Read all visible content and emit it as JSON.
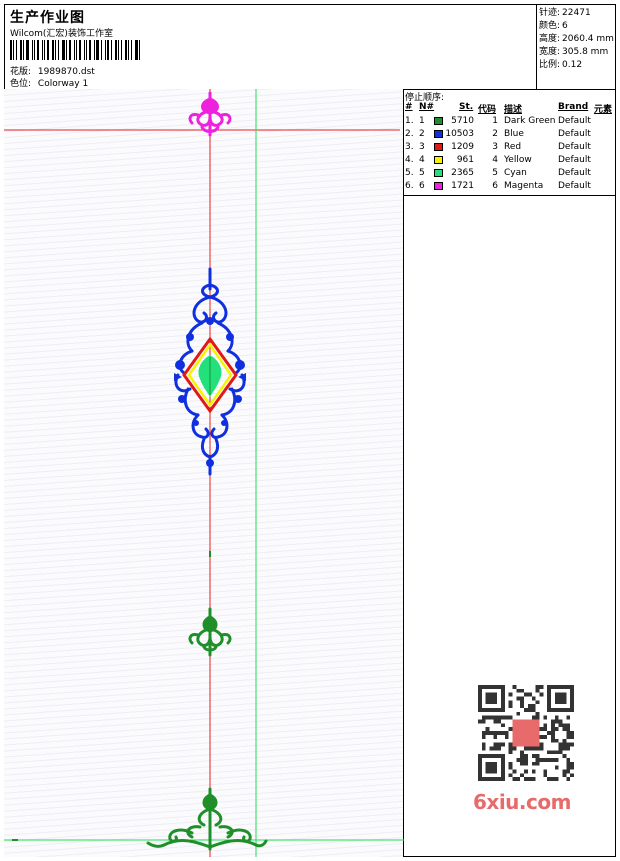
{
  "header": {
    "title": "生产作业图",
    "company": "Wilcom(汇宏)装饰工作室",
    "pattern_label": "花版:",
    "pattern_value": "1989870.dst",
    "colorway_label": "色位:",
    "colorway_value": "Colorway 1"
  },
  "stats": [
    {
      "label": "针迹:",
      "value": "22471"
    },
    {
      "label": "颜色:",
      "value": "6"
    },
    {
      "label": "高度:",
      "value": "2060.4 mm"
    },
    {
      "label": "宽度:",
      "value": "305.8 mm"
    },
    {
      "label": "比例:",
      "value": "0.12"
    }
  ],
  "stop_sequence": {
    "title": "停止顺序:",
    "headers": {
      "num": "#",
      "n": "N#",
      "st": "St.",
      "code": "代码",
      "desc": "描述",
      "brand": "Brand",
      "element": "元素"
    },
    "rows": [
      {
        "num": "1.",
        "n": "1",
        "st": "5710",
        "code": "1",
        "desc": "Dark Green",
        "brand": "Default",
        "color": "#1f8f2a"
      },
      {
        "num": "2.",
        "n": "2",
        "st": "10503",
        "code": "2",
        "desc": "Blue",
        "brand": "Default",
        "color": "#1030e0"
      },
      {
        "num": "3.",
        "n": "3",
        "st": "1209",
        "code": "3",
        "desc": "Red",
        "brand": "Default",
        "color": "#e01818"
      },
      {
        "num": "4.",
        "n": "4",
        "st": "961",
        "code": "4",
        "desc": "Yellow",
        "brand": "Default",
        "color": "#f4f400"
      },
      {
        "num": "5.",
        "n": "5",
        "st": "2365",
        "code": "5",
        "desc": "Cyan",
        "brand": "Default",
        "color": "#22e07a"
      },
      {
        "num": "6.",
        "n": "6",
        "st": "1721",
        "code": "6",
        "desc": "Magenta",
        "brand": "Default",
        "color": "#ee22dd"
      }
    ]
  },
  "watermark": {
    "text": "6xiu.com"
  },
  "colors": {
    "guide_red": "#e02020",
    "guide_green": "#22dd55",
    "magenta": "#ee22dd",
    "blue": "#1030e0",
    "green": "#1f8f2a"
  }
}
